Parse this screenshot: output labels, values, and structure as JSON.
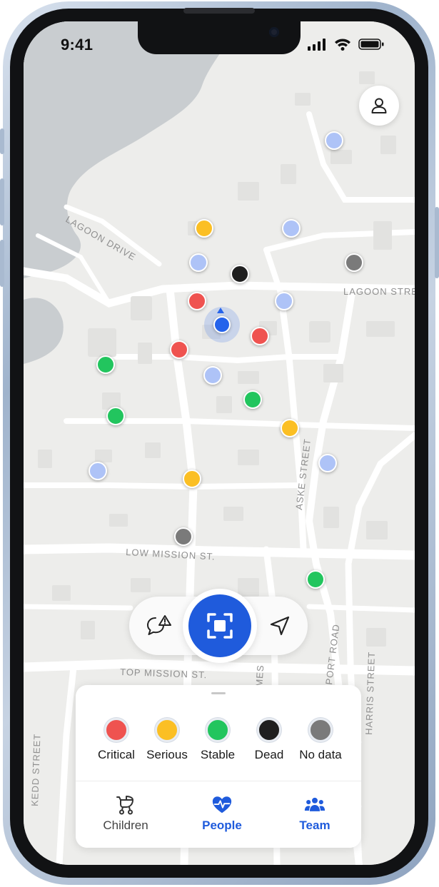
{
  "status_bar": {
    "time": "9:41"
  },
  "map": {
    "street_labels": [
      "LAGOON DRIVE",
      "LAGOON STREET",
      "LOW MISSION ST.",
      "TOP MISSION ST.",
      "ASKE STREET",
      "PORT ROAD",
      "HARRIS STREET",
      "KEDD STREET",
      "JAMES"
    ],
    "markers": [
      {
        "status": "no-data-light"
      },
      {
        "status": "serious"
      },
      {
        "status": "no-data-light"
      },
      {
        "status": "no-data-light"
      },
      {
        "status": "dead"
      },
      {
        "status": "no-data"
      },
      {
        "status": "critical"
      },
      {
        "status": "no-data-light"
      },
      {
        "status": "critical"
      },
      {
        "status": "critical"
      },
      {
        "status": "stable"
      },
      {
        "status": "no-data-light"
      },
      {
        "status": "stable"
      },
      {
        "status": "stable"
      },
      {
        "status": "serious"
      },
      {
        "status": "no-data-light"
      },
      {
        "status": "no-data-light"
      },
      {
        "status": "serious"
      },
      {
        "status": "no-data"
      },
      {
        "status": "stable"
      }
    ]
  },
  "profile": {
    "icon": "person-icon"
  },
  "actions": {
    "report": "chat-alert-icon",
    "scan": "scan-icon",
    "locate": "navigation-arrow-icon"
  },
  "legend": [
    {
      "label": "Critical",
      "color": "#ef5350"
    },
    {
      "label": "Serious",
      "color": "#fbbf24"
    },
    {
      "label": "Stable",
      "color": "#22c55e"
    },
    {
      "label": "Dead",
      "color": "#1f1f1f"
    },
    {
      "label": "No data",
      "color": "#7a7a7a"
    }
  ],
  "tabs": [
    {
      "label": "Children",
      "icon": "stroller-icon",
      "active": false
    },
    {
      "label": "People",
      "icon": "heart-pulse-icon",
      "active": true
    },
    {
      "label": "Team",
      "icon": "team-icon",
      "active": true
    }
  ],
  "colors": {
    "accent": "#1f5bdc",
    "light_marker": "#aec3f7",
    "no_data_marker": "#7a7a7a"
  }
}
